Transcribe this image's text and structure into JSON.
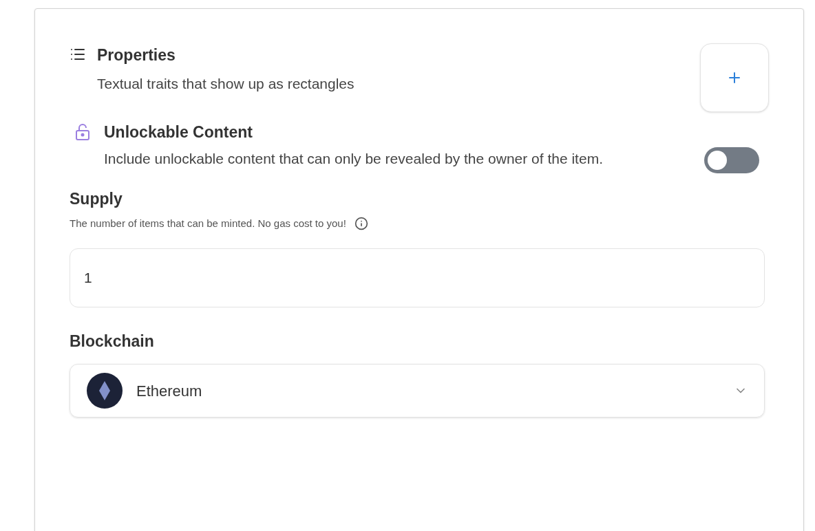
{
  "properties": {
    "title": "Properties",
    "description": "Textual traits that show up as rectangles"
  },
  "unlockable": {
    "title": "Unlockable Content",
    "description": "Include unlockable content that can only be revealed by the owner of the item.",
    "on": false
  },
  "supply": {
    "label": "Supply",
    "hint": "The number of items that can be minted. No gas cost to you!",
    "value": "1"
  },
  "blockchain": {
    "label": "Blockchain",
    "value": "Ethereum"
  }
}
